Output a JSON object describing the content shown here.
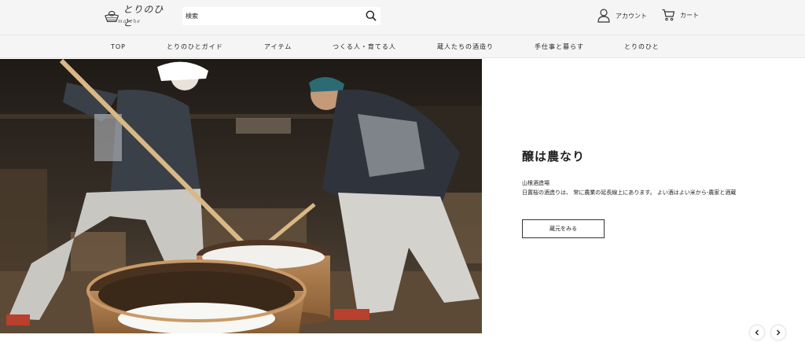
{
  "header": {
    "logo_text": "とりのひと",
    "logo_sub": "marche",
    "search_placeholder": "検索",
    "account_label": "アカウント",
    "cart_label": "カート"
  },
  "nav": {
    "items": [
      {
        "label": "TOP"
      },
      {
        "label": "とりのひとガイド"
      },
      {
        "label": "アイテム"
      },
      {
        "label": "つくる人・育てる人"
      },
      {
        "label": "蔵人たちの酒造り"
      },
      {
        "label": "手仕事と暮らす"
      },
      {
        "label": "とりのひと"
      }
    ]
  },
  "hero": {
    "title": "醸は農なり",
    "brewery": "山根酒造場",
    "description": "日置桜の酒造りは、 常に農業の延長線上にあります。 よい酒はよい米から-農家と酒蔵",
    "button_label": "蔵元をみる"
  },
  "icons": {
    "search": "search-icon",
    "account": "user-icon",
    "cart": "cart-icon",
    "prev": "chevron-left-icon",
    "next": "chevron-right-icon"
  }
}
